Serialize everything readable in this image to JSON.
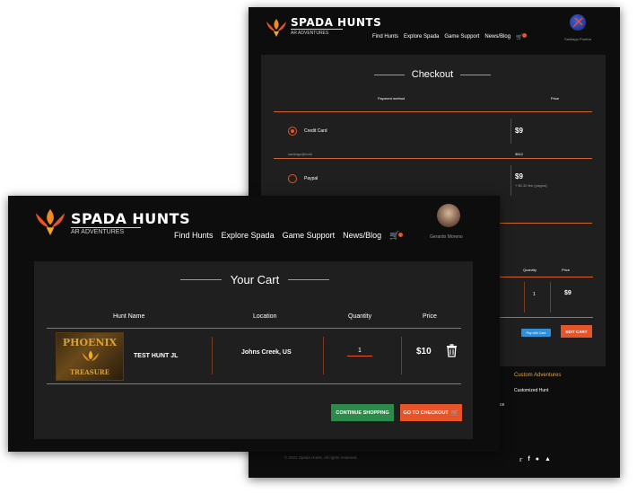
{
  "brand": {
    "name": "SPADA HUNTS",
    "tagline": "AR ADVENTURES"
  },
  "nav": {
    "items": [
      "Find Hunts",
      "Explore Spada",
      "Game Support",
      "News/Blog"
    ]
  },
  "checkout": {
    "user_name": "Santiago Prueba",
    "title": "Checkout",
    "col_payment": "Payment method",
    "col_price": "Price",
    "options": [
      {
        "label": "Credit Card",
        "price": "$9",
        "sub_left": "santiago@mail",
        "sub_right": "3612"
      },
      {
        "label": "Paypal",
        "price": "$9",
        "sub_right": "+ $0.30 fee (paypal)"
      }
    ],
    "table_headers": {
      "quantity": "Quantity",
      "price": "Price"
    },
    "row": {
      "quantity": "1",
      "price": "$9"
    },
    "pay_button": "Pay with Card",
    "edit_button": "EDIT CART",
    "footer_heading": "Custom Adventures",
    "footer_link": "Customized Hunt",
    "footer_fragment": "ce",
    "copyright": "© 2021 Spada Hunts. All rights reserved."
  },
  "cart": {
    "user_name": "Gerardo Moreno",
    "title": "Your Cart",
    "headers": {
      "hunt": "Hunt Name",
      "location": "Location",
      "quantity": "Quantity",
      "price": "Price"
    },
    "item": {
      "name": "TEST HUNT JL",
      "location": "Johns Creek, US",
      "quantity": "1",
      "price": "$10",
      "thumb_top": "PHOENIX",
      "thumb_bottom": "TREASURE"
    },
    "continue_button": "CONTINUE SHOPPING",
    "checkout_button": "GO TO CHECKOUT"
  },
  "colors": {
    "accent": "#e8542a",
    "green": "#2e8a4a",
    "blue": "#2f8fd8",
    "panel": "#1f1f1f",
    "bg": "#0d0d0d"
  }
}
